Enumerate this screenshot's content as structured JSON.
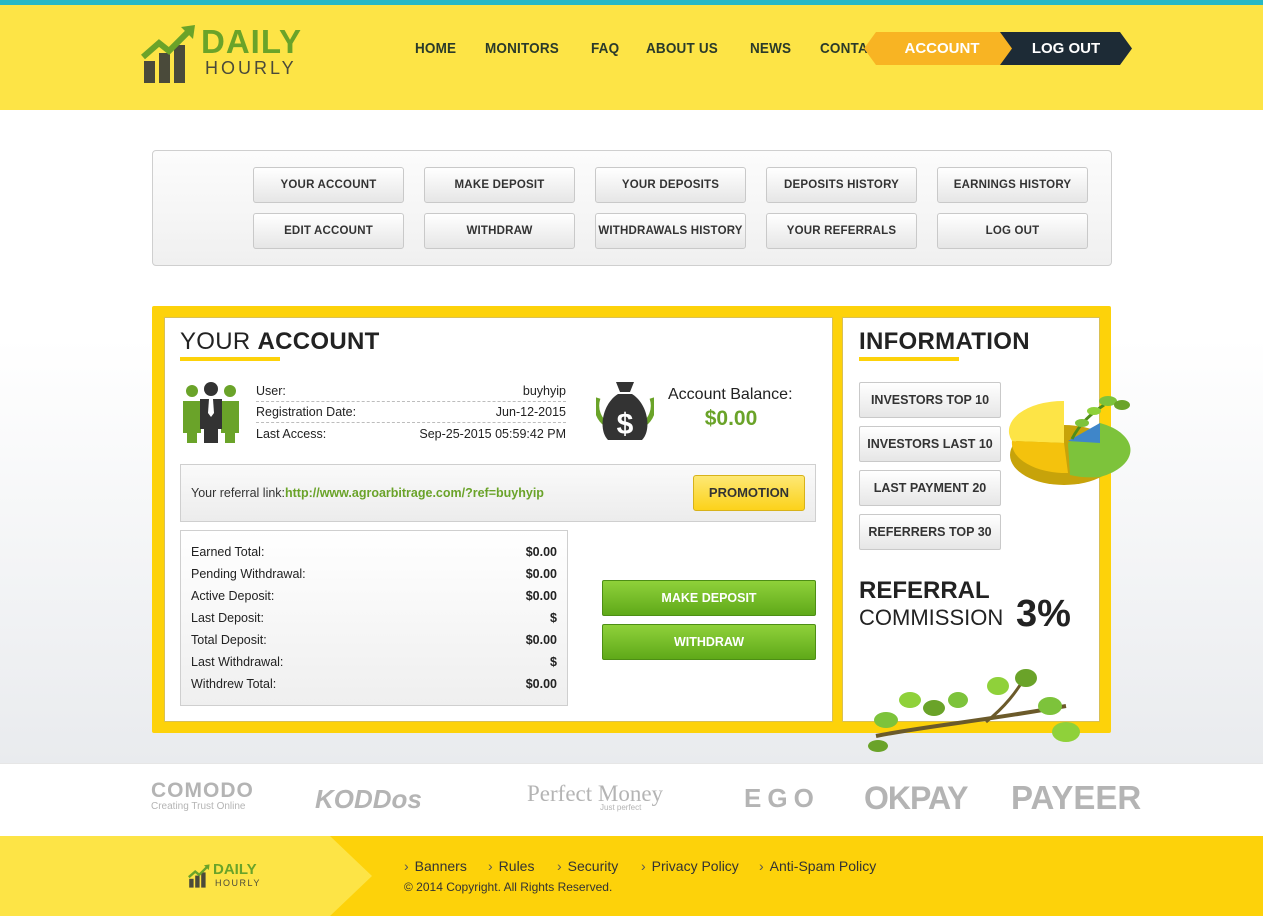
{
  "header": {
    "logo_text_1": "DAILY",
    "logo_text_2": "HOURLY",
    "nav": [
      "HOME",
      "MONITORS",
      "FAQ",
      "ABOUT US",
      "NEWS",
      "CONTACT"
    ],
    "account_label": "ACCOUNT",
    "logout_label": "LOG OUT"
  },
  "account_menu": {
    "row1": [
      "YOUR ACCOUNT",
      "MAKE DEPOSIT",
      "YOUR DEPOSITS",
      "DEPOSITS HISTORY",
      "EARNINGS HISTORY"
    ],
    "row2": [
      "EDIT ACCOUNT",
      "WITHDRAW",
      "WITHDRAWALS HISTORY",
      "YOUR REFERRALS",
      "LOG OUT"
    ]
  },
  "account": {
    "title_light": "YOUR",
    "title_bold": "ACCOUNT",
    "user_label": "User:",
    "user_value": "buyhyip",
    "reg_label": "Registration Date:",
    "reg_value": "Jun-12-2015",
    "access_label": "Last Access:",
    "access_value": "Sep-25-2015 05:59:42 PM",
    "balance_label": "Account Balance:",
    "balance_value": "$0.00",
    "ref_label": "Your referral link:",
    "ref_link": "http://www.agroarbitrage.com/?ref=buyhyip",
    "promotion_label": "PROMOTION",
    "stats": [
      {
        "label": "Earned Total:",
        "value": "$0.00"
      },
      {
        "label": "Pending Withdrawal:",
        "value": "$0.00"
      },
      {
        "label": "Active Deposit:",
        "value": "$0.00"
      },
      {
        "label": "Last Deposit:",
        "value": "$"
      },
      {
        "label": "Total Deposit:",
        "value": "$0.00"
      },
      {
        "label": "Last Withdrawal:",
        "value": "$"
      },
      {
        "label": "Withdrew Total:",
        "value": "$0.00"
      }
    ],
    "make_deposit_label": "MAKE DEPOSIT",
    "withdraw_label": "WITHDRAW"
  },
  "information": {
    "title": "INFORMATION",
    "buttons": [
      "INVESTORS TOP 10",
      "INVESTORS LAST 10",
      "LAST PAYMENT 20",
      "REFERRERS TOP 30"
    ],
    "referral_title": "REFERRAL",
    "commission_label": "COMMISSION",
    "commission_value": "3%"
  },
  "payments": {
    "comodo": "COMODO",
    "comodo_sub": "Creating Trust Online",
    "koddos": "KODDos",
    "perfect_money": "Perfect Money",
    "perfect_money_sub": "Just perfect",
    "egopay": "EGO",
    "okpay": "OKPAY",
    "payeer": "PAYEER"
  },
  "footer": {
    "logo_text_1": "DAILY",
    "logo_text_2": "HOURLY",
    "links": [
      "Banners",
      "Rules",
      "Security",
      "Privacy Policy",
      "Anti-Spam Policy"
    ],
    "copyright": "© 2014 Copyright. All Rights Reserved."
  },
  "colors": {
    "header_yellow": "#fde446",
    "frame_yellow": "#fdd20a",
    "accent_green": "#6aa329",
    "account_orange": "#f8b423",
    "logout_navy": "#1d2b36",
    "top_cyan": "#27b8c4"
  }
}
